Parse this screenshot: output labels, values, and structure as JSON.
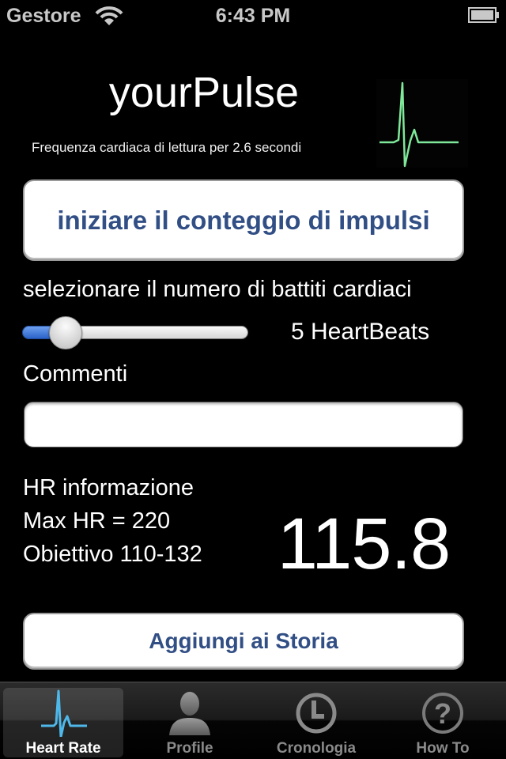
{
  "status_bar": {
    "carrier": "Gestore",
    "time": "6:43 PM",
    "wifi_icon": "wifi-icon",
    "battery_icon": "battery-full-icon"
  },
  "header": {
    "title": "yourPulse",
    "subtitle": "Frequenza cardiaca di lettura per 2.6 secondi",
    "logo_icon": "ecg-pulse-icon",
    "logo_color": "#7fe89a"
  },
  "start_button": {
    "label": "iniziare il conteggio di impulsi"
  },
  "heartbeat_select": {
    "label": "selezionare il numero di battiti cardiaci",
    "value_label": "5 HeartBeats",
    "slider_fraction": 0.14,
    "accent_color": "#2a63c9"
  },
  "comments": {
    "label": "Commenti",
    "value": "",
    "placeholder": ""
  },
  "hr_info": {
    "heading": "HR informazione",
    "max_hr": "Max HR = 220",
    "target": "Obiettivo 110-132",
    "current_value": "115.8"
  },
  "add_history_button": {
    "label": "Aggiungi ai Storia"
  },
  "tabbar": {
    "tabs": [
      {
        "label": "Heart Rate",
        "icon": "ecg-icon",
        "active": true
      },
      {
        "label": "Profile",
        "icon": "person-icon",
        "active": false
      },
      {
        "label": "Cronologia",
        "icon": "clock-icon",
        "active": false
      },
      {
        "label": "How To",
        "icon": "question-icon",
        "active": false
      }
    ],
    "active_color": "#4fb8ea"
  }
}
